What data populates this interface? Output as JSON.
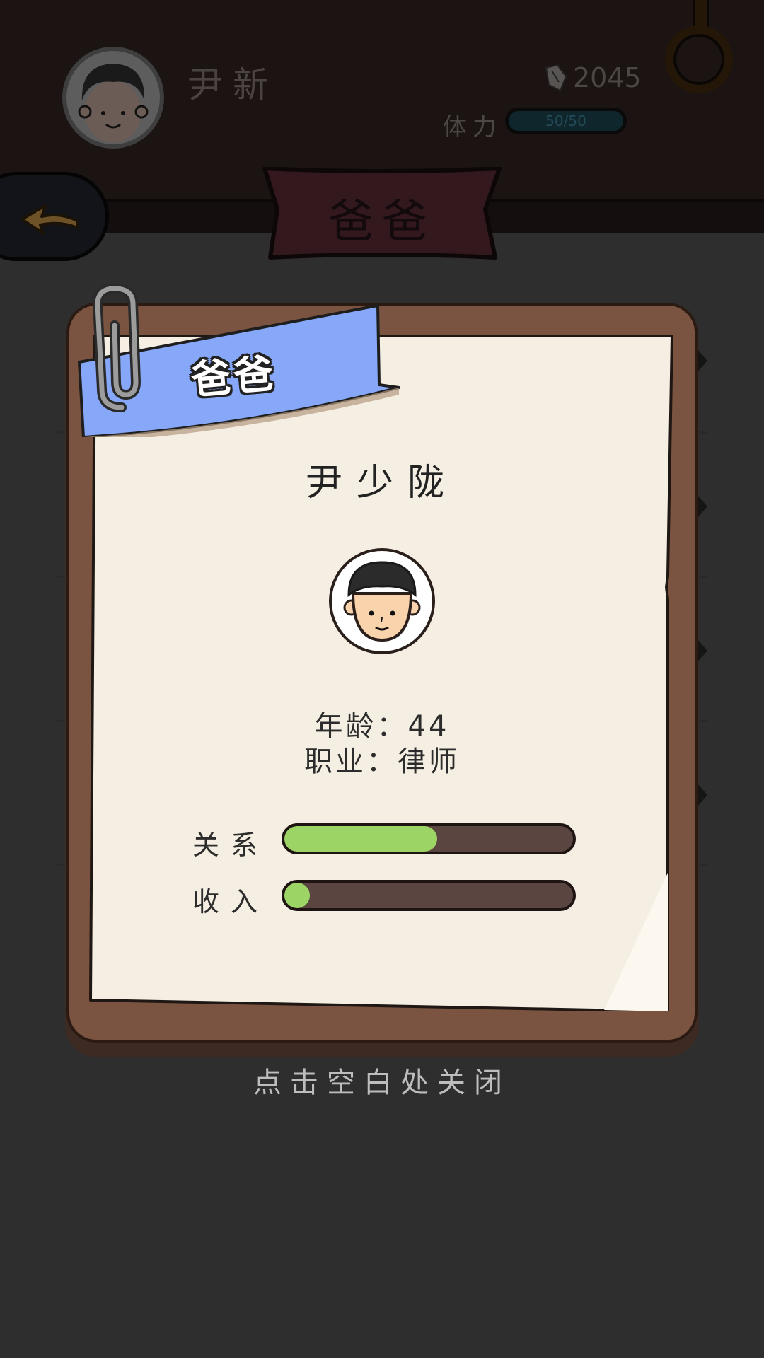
{
  "header": {
    "player_name": "尹新",
    "currency_value": "2045",
    "stamina_label": "体力",
    "stamina_value": "50/50",
    "page_title": "爸爸"
  },
  "card": {
    "ribbon_label": "爸爸",
    "member_name": "尹少陇",
    "age_line": "年龄：44",
    "job_line": "职业：律师",
    "stats": [
      {
        "label": "关系",
        "level": 0.53
      },
      {
        "label": "收入",
        "level": 0.05
      }
    ]
  },
  "close_hint": "点击空白处关闭",
  "colors": {
    "ribbon": "#87a8f8",
    "bar_fill": "#9cd465",
    "card_frame": "#7a5440",
    "paper": "#f5efe3"
  },
  "icons": [
    "player-avatar-icon",
    "gem-icon",
    "ring-icon",
    "back-arrow-icon",
    "paperclip-icon",
    "member-face-icon"
  ]
}
